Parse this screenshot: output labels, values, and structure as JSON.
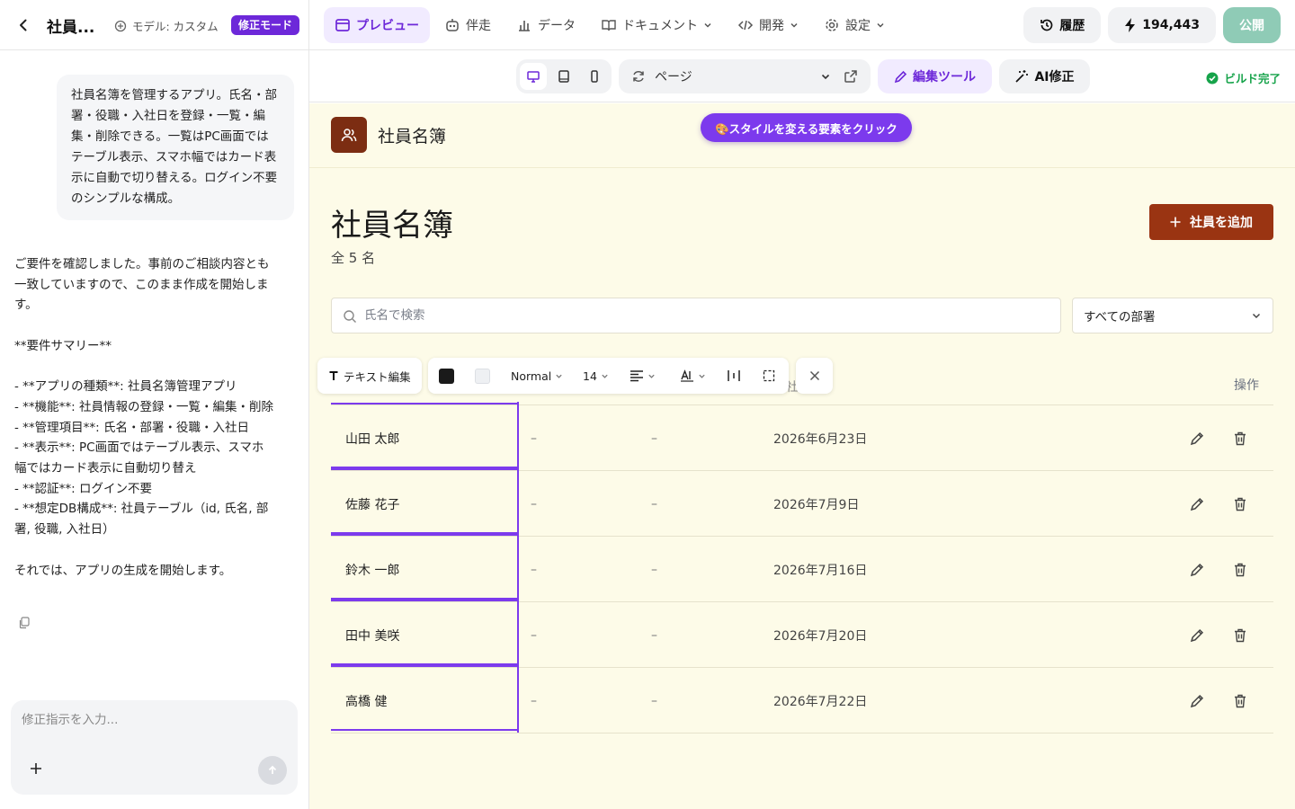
{
  "topbar": {
    "app_title": "社員...",
    "model_label": "モデル: カスタム",
    "mode_badge": "修正モード",
    "nav": [
      {
        "label": "プレビュー",
        "icon": "window-icon"
      },
      {
        "label": "伴走",
        "icon": "robot-icon"
      },
      {
        "label": "データ",
        "icon": "bar-chart-icon"
      },
      {
        "label": "ドキュメント",
        "icon": "book-icon"
      },
      {
        "label": "開発",
        "icon": "code-icon"
      },
      {
        "label": "設定",
        "icon": "gear-icon"
      }
    ],
    "history_label": "履歴",
    "credits": "194,443",
    "publish_label": "公開"
  },
  "chat": {
    "user_message": "社員名簿を管理するアプリ。氏名・部署・役職・入社日を登録・一覧・編集・削除できる。一覧はPC画面ではテーブル表示、スマホ幅ではカード表示に自動で切り替える。ログイン不要のシンプルな構成。",
    "assistant_message": "ご要件を確認しました。事前のご相談内容とも一致していますので、このまま作成を開始します。\n\n**要件サマリー**\n\n- **アプリの種類**: 社員名簿管理アプリ\n- **機能**: 社員情報の登録・一覧・編集・削除\n- **管理項目**: 氏名・部署・役職・入社日\n- **表示**: PC画面ではテーブル表示、スマホ幅ではカード表示に自動切り替え\n- **認証**: ログイン不要\n- **想定DB構成**: 社員テーブル（id, 氏名, 部署, 役職, 入社日）\n\nそれでは、アプリの生成を開始します。",
    "input_placeholder": "修正指示を入力..."
  },
  "preview_toolbar": {
    "page_label": "ページ",
    "edit_tools_label": "編集ツール",
    "ai_fix_label": "AI修正",
    "build_status": "ビルド完了"
  },
  "app": {
    "header_name": "社員名簿",
    "hint": "🎨スタイルを変える要素をクリック",
    "title": "社員名簿",
    "count_text": "全 5 名",
    "add_button": "社員を追加",
    "search_placeholder": "氏名で検索",
    "dept_filter": "すべての部署",
    "header_partial": "社",
    "header_actions": "操作",
    "rows": [
      {
        "name": "山田 太郎",
        "dept": "–",
        "role": "–",
        "date": "2026年6月23日"
      },
      {
        "name": "佐藤 花子",
        "dept": "–",
        "role": "–",
        "date": "2026年7月9日"
      },
      {
        "name": "鈴木 一郎",
        "dept": "–",
        "role": "–",
        "date": "2026年7月16日"
      },
      {
        "name": "田中 美咲",
        "dept": "–",
        "role": "–",
        "date": "2026年7月20日"
      },
      {
        "name": "高橋 健",
        "dept": "–",
        "role": "–",
        "date": "2026年7月22日"
      }
    ]
  },
  "format_toolbar": {
    "text_edit_label": "テキスト編集",
    "text_color": "#1a1a1a",
    "bg_color": "#eef0f3",
    "style_value": "Normal",
    "size_value": "14"
  },
  "colors": {
    "accent": "#6d28d9",
    "primary_button": "#9a3412",
    "logo_bg": "#7c2d12",
    "selection": "#7c3aed",
    "success": "#16a34a",
    "canvas_bg": "#fdfbe8"
  }
}
